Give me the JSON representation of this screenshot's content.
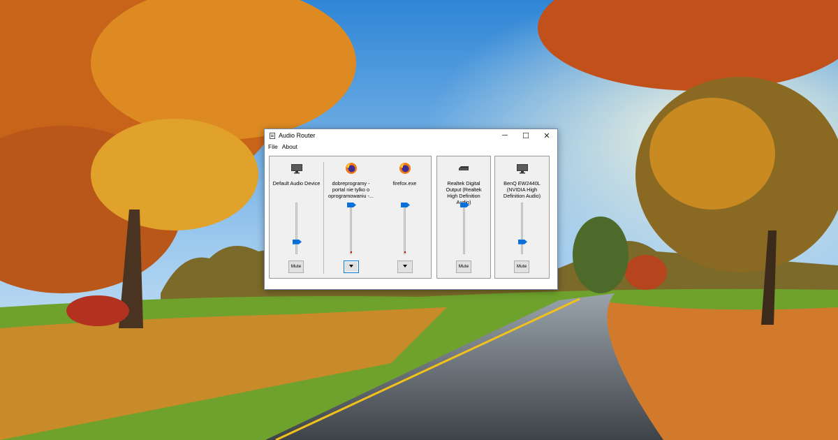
{
  "window": {
    "title": "Audio Router",
    "controls": {
      "minimize": "─",
      "maximize": "☐",
      "close": "✕"
    }
  },
  "menu": {
    "items": [
      "File",
      "About"
    ]
  },
  "colors": {
    "slider_thumb": "#0b6fd8",
    "peak_marker": "#d00000",
    "panel_bg": "#f0f0f0",
    "button_bg": "#e1e1e1"
  },
  "panels": [
    {
      "strips": [
        {
          "icon": "monitor-icon",
          "label": "Default Audio Device",
          "volume": 0.2,
          "action": "Mute"
        },
        {
          "icon": "firefox-icon",
          "label": "dobreprogramy - portal nie tylko o oprogramowaniu -...",
          "volume": 1.0,
          "action": "route-dropdown"
        },
        {
          "icon": "firefox-icon",
          "label": "firefox.exe",
          "volume": 1.0,
          "action": "route-dropdown"
        }
      ]
    },
    {
      "strips": [
        {
          "icon": "receiver-icon",
          "label": "Realtek Digital Output (Realtek High Definition Audio)",
          "volume": 1.0,
          "action": "Mute"
        }
      ]
    },
    {
      "strips": [
        {
          "icon": "monitor-icon",
          "label": "BenQ EW2440L (NVIDIA High Definition Audio)",
          "volume": 0.2,
          "action": "Mute"
        }
      ]
    }
  ]
}
